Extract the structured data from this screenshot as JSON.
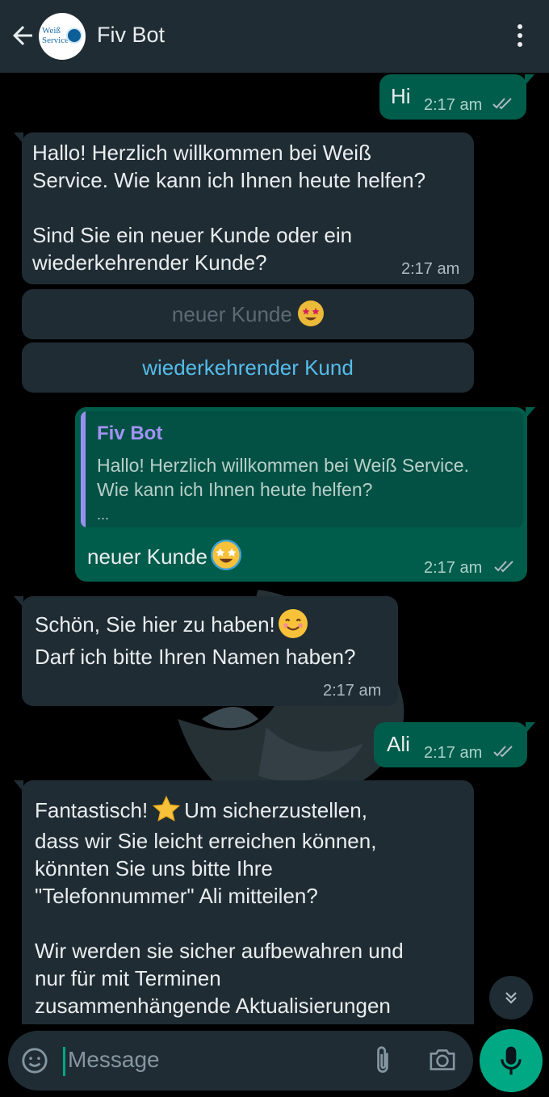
{
  "header": {
    "contact_name": "Fiv Bot",
    "avatar_text": "Weiß\nService",
    "back_icon": "arrow-left-icon",
    "menu_icon": "more-vertical-icon"
  },
  "messages": [
    {
      "from": "me",
      "text": "Hi",
      "time": "2:17 am",
      "status": "read-double-check"
    },
    {
      "from": "bot",
      "text": "Hallo! Herzlich willkommen bei Weiß\nService. Wie kann ich Ihnen heute helfen?\n\nSind Sie ein neuer Kunde oder ein\nwiederkehrender Kunde?",
      "time": "2:17 am"
    },
    {
      "from": "me",
      "quote_name": "Fiv Bot",
      "quote_text": "Hallo! Herzlich willkommen bei Weiß Service.\nWie kann ich Ihnen heute helfen?",
      "quote_more": "...",
      "text": "neuer Kunde",
      "time": "2:17 am"
    },
    {
      "from": "bot",
      "line1": "Schön, Sie hier zu haben!",
      "line2": "Darf ich bitte Ihren Namen haben?",
      "time": "2:17 am"
    },
    {
      "from": "me",
      "text": "Ali",
      "time": "2:17 am"
    },
    {
      "from": "bot",
      "first": "Fantastisch!",
      "first_rest": "Um sicherzustellen,",
      "text": "dass wir Sie leicht erreichen können,\nkönnten Sie uns bitte Ihre\n\"Telefonnummer\" Ali mitteilen?\n\nWir werden sie sicher aufbewahren und\nnur für mit Terminen\nzusammenhängende Aktualisierungen"
    }
  ],
  "quick_replies": [
    {
      "label": "neuer Kunde",
      "state": "disabled"
    },
    {
      "label": "wiederkehrender Kund",
      "state": "active"
    }
  ],
  "composer": {
    "placeholder": "Message",
    "emoji_icon": "emoji-icon",
    "attach_icon": "paperclip-icon",
    "camera_icon": "camera-icon",
    "mic_icon": "microphone-icon"
  },
  "colors": {
    "header_bg": "#1f2c34",
    "incoming_bubble": "#202c33",
    "outgoing_bubble": "#005c4b",
    "accent_green": "#00a884",
    "link_blue": "#53bdeb"
  }
}
